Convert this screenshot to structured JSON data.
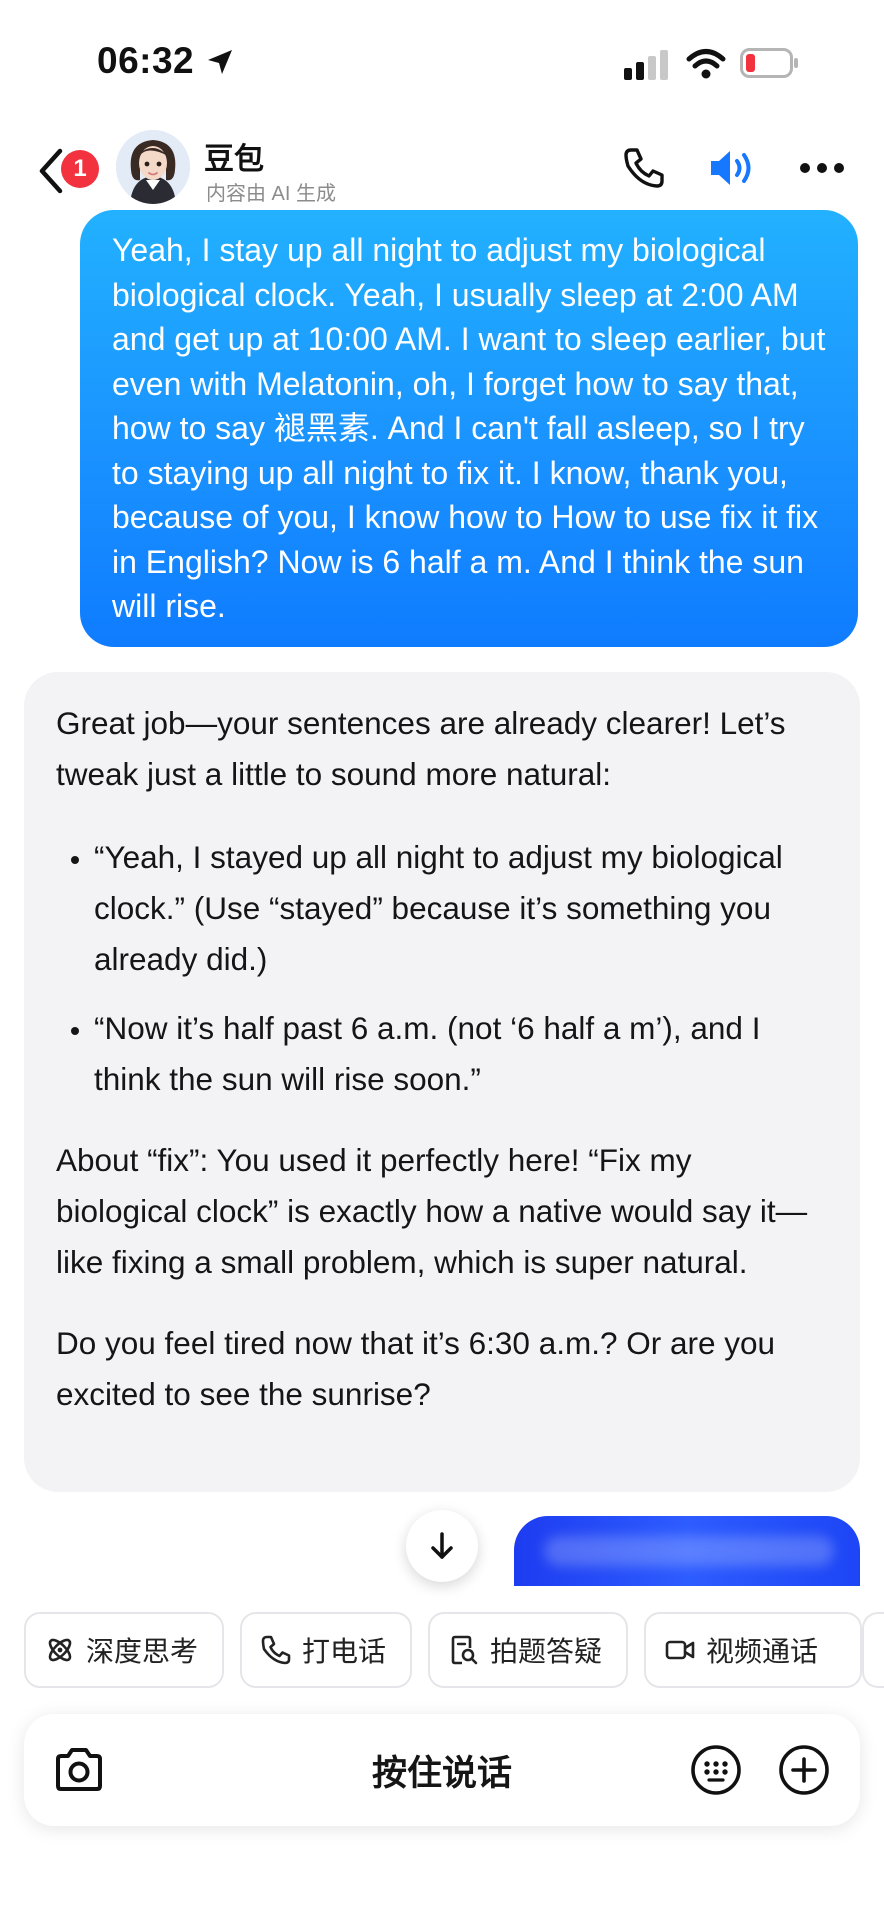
{
  "status_bar": {
    "time": "06:32"
  },
  "header": {
    "unread_count": "1",
    "bot_name": "豆包",
    "bot_subtitle": "内容由 AI 生成"
  },
  "messages": {
    "user_text": "Yeah, I stay up all night to adjust my biological biological clock. Yeah, I usually sleep at 2:00 AM and get up at 10:00 AM. I want to sleep earlier, but even with Melatonin, oh, I forget how to say that, how to say 褪黑素. And I can't fall asleep, so I try to staying up all night to fix it. I know, thank you, because of you, I know how to How to use fix it fix in English? Now is 6 half a m. And I think the sun will rise.",
    "ai_intro": "Great job—your sentences are already clearer! Let’s tweak just a little to sound more natural:",
    "ai_bullets": [
      "“Yeah, I stayed up all night to adjust my biological clock.” (Use “stayed” because it’s something you already did.)",
      "“Now it’s half past 6 a.m. (not ‘6 half a m’), and I think the sun will rise soon.”"
    ],
    "ai_fix_note": "About “fix”: You used it perfectly here! “Fix my biological clock” is exactly how a native would say it—like fixing a small problem, which is super natural.",
    "ai_question": "Do you feel tired now that it’s 6:30 a.m.? Or are you excited to see the sunrise?"
  },
  "quick_actions": [
    {
      "label": "深度思考",
      "icon": "atom-icon"
    },
    {
      "label": "打电话",
      "icon": "phone-icon"
    },
    {
      "label": "拍题答疑",
      "icon": "search-doc-icon"
    },
    {
      "label": "视频通话",
      "icon": "video-icon"
    }
  ],
  "input_bar": {
    "talk_label": "按住说话"
  },
  "colors": {
    "user_bubble": "#1a92ff",
    "assistant_bubble": "#f3f3f6",
    "accent": "#1677ff",
    "badge": "#f2323f"
  }
}
